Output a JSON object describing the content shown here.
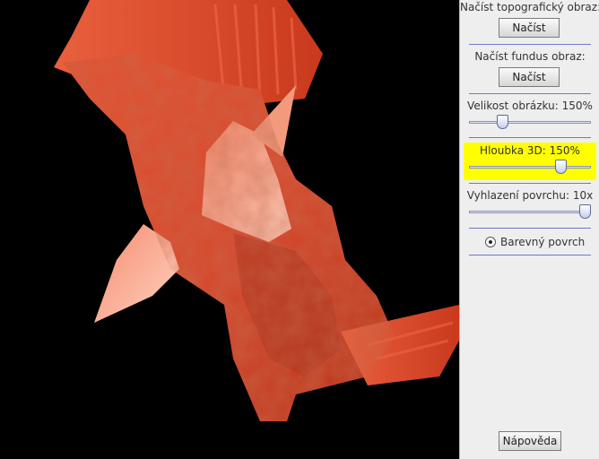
{
  "colors": {
    "panel_bg": "#eeeeee",
    "separator": "#6f79c4",
    "highlight": "#ffff00",
    "surface_base": "#d9472b",
    "surface_light": "#f7b49b",
    "surface_dark": "#8f2413"
  },
  "panel": {
    "topo_label": "Načíst topografický obraz:",
    "topo_button": "Načíst",
    "fundus_label": "Načíst fundus obraz:",
    "fundus_button": "Načíst",
    "image_size": {
      "label": "Velikost obrázku:",
      "value": "150%",
      "level": 0.25
    },
    "depth": {
      "label": "Hloubka 3D:",
      "value": "150%",
      "level": 0.78
    },
    "smoothing": {
      "label": "Vyhlazení povrchu:",
      "value": "10x",
      "level": 1.0
    },
    "color_surface": {
      "label": "Barevný povrch",
      "checked": true
    },
    "help_button": "Nápověda"
  },
  "viewport": {
    "content": "3D colored surface render",
    "icon": "3d-surface"
  }
}
